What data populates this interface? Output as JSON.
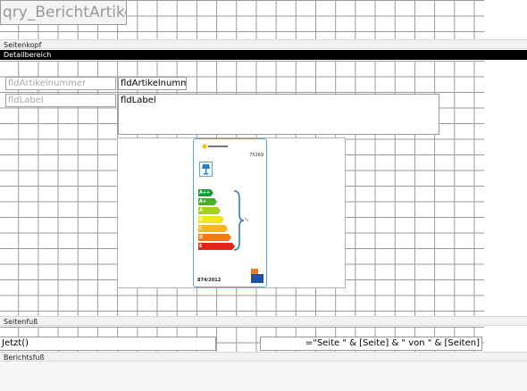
{
  "report": {
    "title": "qry_BerichtArtikel"
  },
  "sections": {
    "page_header": "Seitenkopf",
    "detail": "Detailbereich",
    "page_footer": "Seitenfuß",
    "report_footer": "Berichtsfuß"
  },
  "detail": {
    "label_artikelnummer": "fldArtikelnummer",
    "field_artikelnummer": "fldArtikelnumm",
    "label_label": "fldLabel",
    "field_label": "fldLabel"
  },
  "footer": {
    "date_expr": "Jetzt()",
    "page_expr": "=\"Seite \" & [Seite] & \" von \" & [Seiten]"
  },
  "energy_label": {
    "brand": "B•K LEUCHTEN",
    "model": "75269",
    "classes": [
      "A++",
      "A+",
      "A",
      "B",
      "C",
      "D",
      "E"
    ],
    "regulation": "874/2012",
    "colors": [
      "#1a9a3a",
      "#4caf2a",
      "#a6cf1e",
      "#f0e81e",
      "#f7b51c",
      "#ef7a1a",
      "#e3241b"
    ]
  }
}
